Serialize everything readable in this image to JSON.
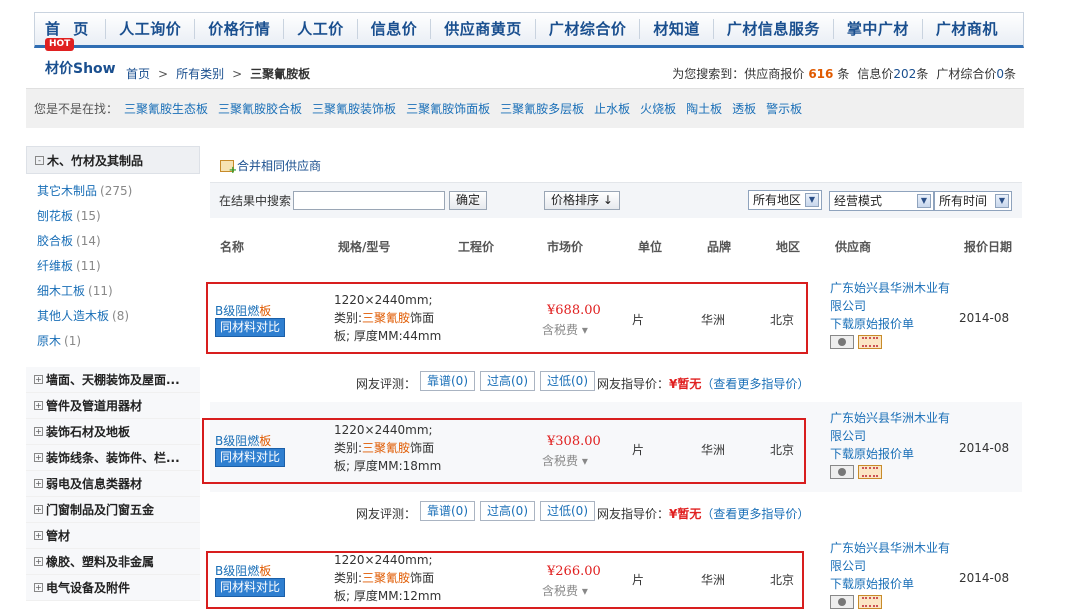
{
  "nav": {
    "items": [
      "首 页",
      "人工询价",
      "价格行情",
      "人工价",
      "信息价",
      "供应商黄页",
      "广材综合价",
      "材知道",
      "广材信息服务",
      "掌中广材",
      "广材商机"
    ],
    "hot_badge": "HOT"
  },
  "header": {
    "brand": "材价Show",
    "breadcrumb": {
      "home": "首页",
      "sep1": ">",
      "all": "所有类别",
      "sep2": ">",
      "current": "三聚氰胺板"
    },
    "counts": {
      "prefix": "为您搜索到：供应商报价",
      "supplier_count": "616",
      "unit1": "条",
      "info_label": "信息价",
      "info_count": "202",
      "unit2": "条",
      "composite_label": "广材综合价",
      "composite_count": "0",
      "unit3": "条"
    }
  },
  "suggest": {
    "label": "您是不是在找：",
    "keywords": [
      "三聚氰胺生态板",
      "三聚氰胺胶合板",
      "三聚氰胺装饰板",
      "三聚氰胺饰面板",
      "三聚氰胺多层板",
      "止水板",
      "火烧板",
      "陶土板",
      "透板",
      "警示板"
    ]
  },
  "sidebar": {
    "header": "木、竹材及其制品",
    "header_box": "-",
    "subs": [
      {
        "label": "其它木制品",
        "count": "(275)"
      },
      {
        "label": "刨花板",
        "count": "(15)"
      },
      {
        "label": "胶合板",
        "count": "(14)"
      },
      {
        "label": "纤维板",
        "count": "(11)"
      },
      {
        "label": "细木工板",
        "count": "(11)"
      },
      {
        "label": "其他人造木板",
        "count": "(8)"
      },
      {
        "label": "原木",
        "count": "(1)"
      }
    ],
    "cats": [
      "墙面、天棚装饰及屋面...",
      "管件及管道用器材",
      "装饰石材及地板",
      "装饰线条、装饰件、栏...",
      "弱电及信息类器材",
      "门窗制品及门窗五金",
      "管材",
      "橡胶、塑料及非金属",
      "电气设备及附件"
    ],
    "cat_box": "+"
  },
  "main": {
    "merge_label": "合并相同供应商",
    "search_label": "在结果中搜索",
    "search_value": "",
    "ok_label": "确定",
    "sort_label": "价格排序 ↓",
    "region": "所有地区",
    "mode": "经营模式",
    "time": "所有时间",
    "dropdown_arrow": "▼",
    "columns": [
      "名称",
      "规格/型号",
      "工程价",
      "市场价",
      "单位",
      "品牌",
      "地区",
      "供应商",
      "报价日期"
    ]
  },
  "rows": [
    {
      "name_prefix": "B级阻燃",
      "name_hl": "板",
      "compare": "同材料对比",
      "spec_a": "1220×2440mm; 类别:",
      "spec_hl": "三聚氰胺",
      "spec_b": "饰面板; 厚度MM:44mm",
      "price": "¥688.00",
      "tax": "含税费 ▾",
      "unit": "片",
      "brand": "华洲",
      "area": "北京",
      "supplier": "广东始兴县华洲木业有限公司",
      "download": "下载原始报价单",
      "date": "2014-08"
    },
    {
      "name_prefix": "B级阻燃",
      "name_hl": "板",
      "compare": "同材料对比",
      "spec_a": "1220×2440mm; 类别:",
      "spec_hl": "三聚氰胺",
      "spec_b": "饰面板; 厚度MM:18mm",
      "price": "¥308.00",
      "tax": "含税费 ▾",
      "unit": "片",
      "brand": "华洲",
      "area": "北京",
      "supplier": "广东始兴县华洲木业有限公司",
      "download": "下载原始报价单",
      "date": "2014-08"
    },
    {
      "name_prefix": "B级阻燃",
      "name_hl": "板",
      "compare": "同材料对比",
      "spec_a": "1220×2440mm; 类别:",
      "spec_hl": "三聚氰胺",
      "spec_b": "饰面板; 厚度MM:12mm",
      "price": "¥266.00",
      "tax": "含税费 ▾",
      "unit": "片",
      "brand": "华洲",
      "area": "北京",
      "supplier": "广东始兴县华洲木业有限公司",
      "download": "下载原始报价单",
      "date": "2014-08"
    }
  ],
  "review": {
    "label": "网友评测：",
    "good": "靠谱(0)",
    "high": "过高(0)",
    "low": "过低(0)",
    "guide_label": "网友指导价：",
    "guide_value": "¥暂无",
    "more": "（查看更多指导价）"
  }
}
